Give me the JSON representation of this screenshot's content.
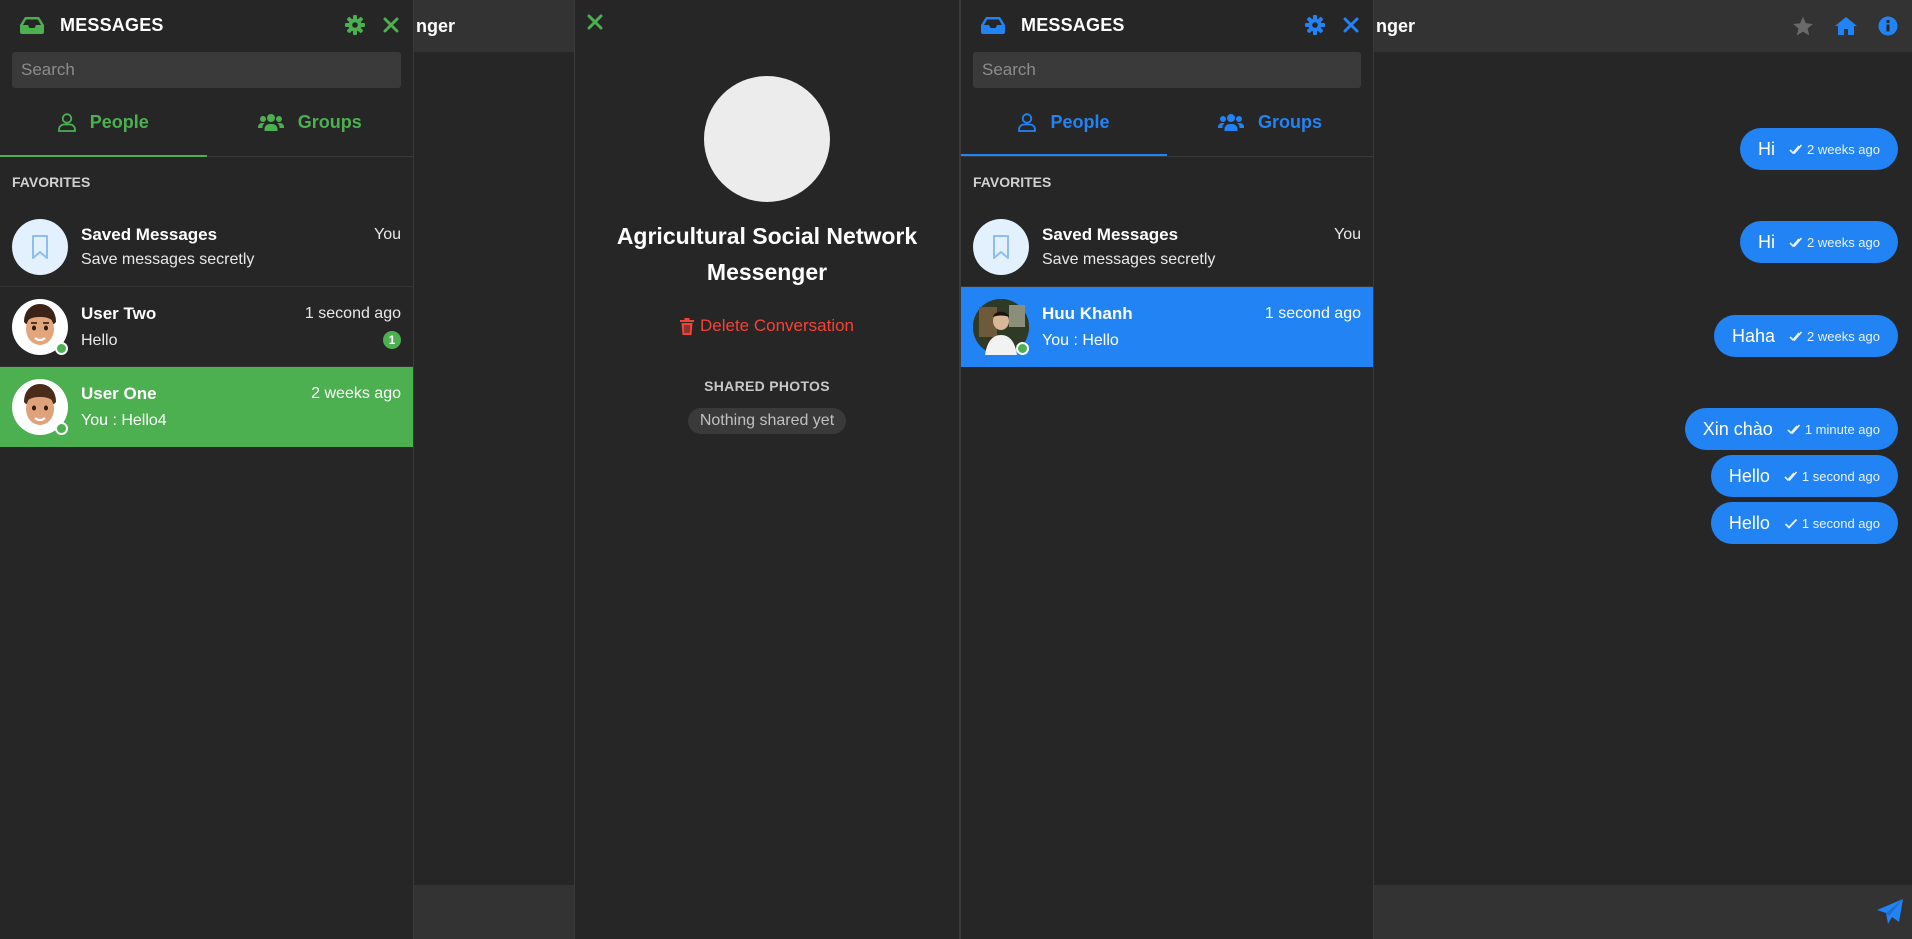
{
  "colors": {
    "green": "#4caf50",
    "blue": "#2183f4",
    "red": "#f44336"
  },
  "left_sidebar": {
    "title": "MESSAGES",
    "search_placeholder": "Search",
    "tabs": [
      {
        "label": "People"
      },
      {
        "label": "Groups"
      }
    ],
    "favorites_label": "FAVORITES",
    "saved": {
      "name": "Saved Messages",
      "tag": "You",
      "message": "Save messages secretly"
    },
    "contacts": [
      {
        "name": "User Two",
        "time": "1 second ago",
        "message": "Hello",
        "badge": "1"
      },
      {
        "name": "User One",
        "time": "2 weeks ago",
        "message": "You : Hello4"
      }
    ]
  },
  "left_chat": {
    "title_fragment": "nger"
  },
  "info_panel": {
    "title": "Agricultural Social Network Messenger",
    "delete_label": "Delete Conversation",
    "shared_label": "SHARED PHOTOS",
    "shared_empty": "Nothing shared yet"
  },
  "right_sidebar": {
    "title": "MESSAGES",
    "search_placeholder": "Search",
    "tabs": [
      {
        "label": "People"
      },
      {
        "label": "Groups"
      }
    ],
    "favorites_label": "FAVORITES",
    "saved": {
      "name": "Saved Messages",
      "tag": "You",
      "message": "Save messages secretly"
    },
    "contacts": [
      {
        "name": "Huu Khanh",
        "time": "1 second ago",
        "message": "You : Hello"
      }
    ]
  },
  "right_chat": {
    "title_fragment": "nger",
    "messages": [
      {
        "text": "Hi",
        "time": "2 weeks ago",
        "status": "seen"
      },
      {
        "text": "Hi",
        "time": "2 weeks ago",
        "status": "seen"
      },
      {
        "text": "Haha",
        "time": "2 weeks ago",
        "status": "seen"
      },
      {
        "text": "Xin chào",
        "time": "1 minute ago",
        "status": "seen"
      },
      {
        "text": "Hello",
        "time": "1 second ago",
        "status": "seen"
      },
      {
        "text": "Hello",
        "time": "1 second ago",
        "status": "sent"
      }
    ]
  }
}
